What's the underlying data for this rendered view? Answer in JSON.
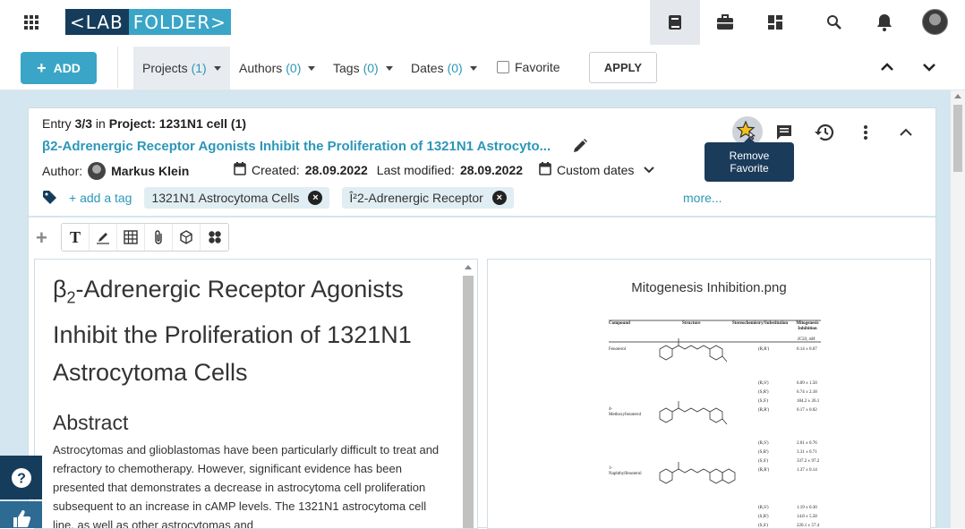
{
  "topbar": {
    "logo_left": "<LAB",
    "logo_right": "FOLDER>",
    "icons": [
      "apps-grid-icon",
      "notebook-icon",
      "briefcase-icon",
      "dashboard-icon",
      "search-icon",
      "bell-icon",
      "user-avatar"
    ]
  },
  "filterbar": {
    "add_label": "ADD",
    "filters": [
      {
        "label": "Projects",
        "count": "(1)"
      },
      {
        "label": "Authors",
        "count": "(0)"
      },
      {
        "label": "Tags",
        "count": "(0)"
      },
      {
        "label": "Dates",
        "count": "(0)"
      }
    ],
    "favorite_label": "Favorite",
    "apply_label": "APPLY"
  },
  "entry": {
    "entry_prefix": "Entry ",
    "entry_pos": "3/3",
    "in_label": " in ",
    "project": "Project: 1231N1 cell (1)",
    "title": "β2-Adrenergic Receptor Agonists Inhibit the Proliferation of 1321N1 Astrocyto...",
    "author_label": "Author:",
    "author_name": "Markus Klein",
    "created_label": "Created:",
    "created": "28.09.2022",
    "modified_label": "Last modified:",
    "modified": "28.09.2022",
    "custom_dates": "Custom dates",
    "add_tag": "+ add a tag",
    "tags": [
      "1321N1 Astrocytoma Cells",
      "Î²2-Adrenergic Receptor"
    ],
    "more": "more...",
    "tooltip_line1": "Remove",
    "tooltip_line2": "Favorite"
  },
  "text_element": {
    "title_pre": "β",
    "title_sub": "2",
    "title_post": "-Adrenergic Receptor Agonists Inhibit the Proliferation of 1321N1 Astrocytoma Cells",
    "heading": "Abstract",
    "paragraph": "Astrocytomas and glioblastomas have been particularly difficult to treat and refractory to chemotherapy. However, significant evidence has been presented that demonstrates a decrease in astrocytoma cell proliferation subsequent to an increase in cAMP levels. The 1321N1 astrocytoma cell line, as well as other astrocytomas and"
  },
  "image_element": {
    "filename": "Mitogenesis Inhibition.png",
    "table_headers": [
      "Compound",
      "Structure",
      "Stereochemistry/Substitution",
      "Mitogenesis Inhibition"
    ],
    "unit": "IC50, nM",
    "compounds": [
      "Fenoterol",
      "4-Methoxyfenoterol",
      "1-Naphthylfenoterol"
    ],
    "stereo": [
      "(R,R')",
      "(R,S')",
      "(S,R')",
      "(S,S')",
      "(R,R')",
      "(R,S')",
      "(S,R')",
      "(S,S')",
      "(R,R')",
      "(R,S')",
      "(S,R')",
      "(S,S')"
    ],
    "values": [
      "0.14 ± 0.07",
      "6.09 ± 1.50",
      "6.74 ± 2.18",
      "184.2 ± 26.1",
      "0.17 ± 0.02",
      "2.01 ± 0.76",
      "3.31 ± 0.71",
      "337.2 ± 97.2",
      "1.37 ± 0.14",
      "1.19 ± 0.30",
      "14.8 ± 5.58",
      "220.1 ± 57.4"
    ]
  },
  "colors": {
    "accent": "#3ba5c7",
    "navy": "#163c5c",
    "canvas": "#d4e6ef"
  }
}
